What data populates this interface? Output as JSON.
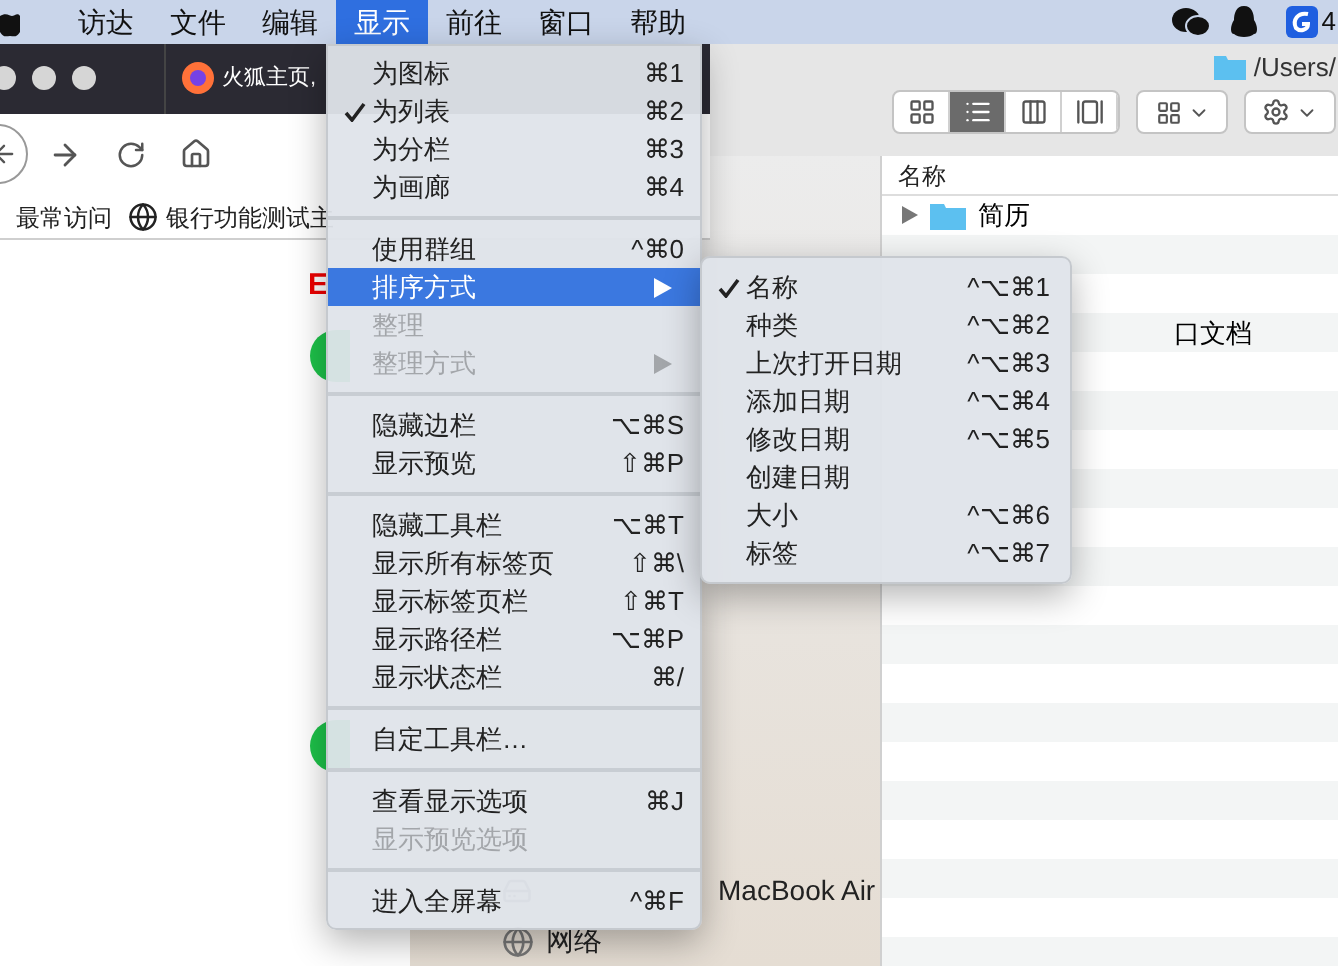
{
  "menubar": {
    "items": [
      {
        "label": "访达",
        "selected": false
      },
      {
        "label": "文件",
        "selected": false
      },
      {
        "label": "编辑",
        "selected": false
      },
      {
        "label": "显示",
        "selected": true
      },
      {
        "label": "前往",
        "selected": false
      },
      {
        "label": "窗口",
        "selected": false
      },
      {
        "label": "帮助",
        "selected": false
      }
    ],
    "status_text": "4"
  },
  "browser": {
    "tab_title": "火狐主页,",
    "bookmarks": [
      {
        "label": "最常访问",
        "kind": "plain"
      },
      {
        "label": "银行功能测试主",
        "kind": "globe"
      }
    ],
    "page_mark": "E"
  },
  "finder": {
    "path": "/Users/",
    "view_buttons": [
      {
        "kind": "icons",
        "selected": false
      },
      {
        "kind": "list",
        "selected": true
      },
      {
        "kind": "columns",
        "selected": false
      },
      {
        "kind": "gallery",
        "selected": false
      }
    ],
    "column_header": "名称",
    "rows": [
      {
        "kind": "folder",
        "name": "简历"
      },
      {
        "kind": "blank"
      },
      {
        "kind": "blank"
      },
      {
        "kind": "file",
        "name": "口文档"
      }
    ],
    "sidebar": [
      {
        "kind": "device",
        "label": "MacBook Air"
      },
      {
        "kind": "network",
        "label": "网络"
      }
    ]
  },
  "view_menu": [
    {
      "kind": "item",
      "label": "为图标",
      "shortcut": "⌘1",
      "checked": false,
      "disabled": false,
      "selected": false,
      "submenu": false
    },
    {
      "kind": "item",
      "label": "为列表",
      "shortcut": "⌘2",
      "checked": true,
      "disabled": false,
      "selected": false,
      "submenu": false
    },
    {
      "kind": "item",
      "label": "为分栏",
      "shortcut": "⌘3",
      "checked": false,
      "disabled": false,
      "selected": false,
      "submenu": false
    },
    {
      "kind": "item",
      "label": "为画廊",
      "shortcut": "⌘4",
      "checked": false,
      "disabled": false,
      "selected": false,
      "submenu": false
    },
    {
      "kind": "separator"
    },
    {
      "kind": "item",
      "label": "使用群组",
      "shortcut": "^⌘0",
      "checked": false,
      "disabled": false,
      "selected": false,
      "submenu": false
    },
    {
      "kind": "item",
      "label": "排序方式",
      "checked": false,
      "disabled": false,
      "selected": true,
      "submenu": true
    },
    {
      "kind": "item",
      "label": "整理",
      "checked": false,
      "disabled": true,
      "selected": false,
      "submenu": false
    },
    {
      "kind": "item",
      "label": "整理方式",
      "checked": false,
      "disabled": true,
      "selected": false,
      "submenu": true
    },
    {
      "kind": "separator"
    },
    {
      "kind": "item",
      "label": "隐藏边栏",
      "shortcut": "⌥⌘S",
      "checked": false,
      "disabled": false,
      "selected": false,
      "submenu": false
    },
    {
      "kind": "item",
      "label": "显示预览",
      "shortcut": "⇧⌘P",
      "checked": false,
      "disabled": false,
      "selected": false,
      "submenu": false
    },
    {
      "kind": "separator"
    },
    {
      "kind": "item",
      "label": "隐藏工具栏",
      "shortcut": "⌥⌘T",
      "checked": false,
      "disabled": false,
      "selected": false,
      "submenu": false
    },
    {
      "kind": "item",
      "label": "显示所有标签页",
      "shortcut": "⇧⌘\\",
      "checked": false,
      "disabled": false,
      "selected": false,
      "submenu": false
    },
    {
      "kind": "item",
      "label": "显示标签页栏",
      "shortcut": "⇧⌘T",
      "checked": false,
      "disabled": false,
      "selected": false,
      "submenu": false
    },
    {
      "kind": "item",
      "label": "显示路径栏",
      "shortcut": "⌥⌘P",
      "checked": false,
      "disabled": false,
      "selected": false,
      "submenu": false
    },
    {
      "kind": "item",
      "label": "显示状态栏",
      "shortcut": "⌘/",
      "checked": false,
      "disabled": false,
      "selected": false,
      "submenu": false
    },
    {
      "kind": "separator"
    },
    {
      "kind": "item",
      "label": "自定工具栏…",
      "checked": false,
      "disabled": false,
      "selected": false,
      "submenu": false
    },
    {
      "kind": "separator"
    },
    {
      "kind": "item",
      "label": "查看显示选项",
      "shortcut": "⌘J",
      "checked": false,
      "disabled": false,
      "selected": false,
      "submenu": false
    },
    {
      "kind": "item",
      "label": "显示预览选项",
      "checked": false,
      "disabled": true,
      "selected": false,
      "submenu": false
    },
    {
      "kind": "separator"
    },
    {
      "kind": "item",
      "label": "进入全屏幕",
      "shortcut": "^⌘F",
      "checked": false,
      "disabled": false,
      "selected": false,
      "submenu": false
    }
  ],
  "sort_menu": [
    {
      "label": "名称",
      "shortcut": "^⌥⌘1",
      "checked": true
    },
    {
      "label": "种类",
      "shortcut": "^⌥⌘2",
      "checked": false
    },
    {
      "label": "上次打开日期",
      "shortcut": "^⌥⌘3",
      "checked": false
    },
    {
      "label": "添加日期",
      "shortcut": "^⌥⌘4",
      "checked": false
    },
    {
      "label": "修改日期",
      "shortcut": "^⌥⌘5",
      "checked": false
    },
    {
      "label": "创建日期",
      "checked": false
    },
    {
      "label": "大小",
      "shortcut": "^⌥⌘6",
      "checked": false
    },
    {
      "label": "标签",
      "shortcut": "^⌥⌘7",
      "checked": false
    }
  ]
}
